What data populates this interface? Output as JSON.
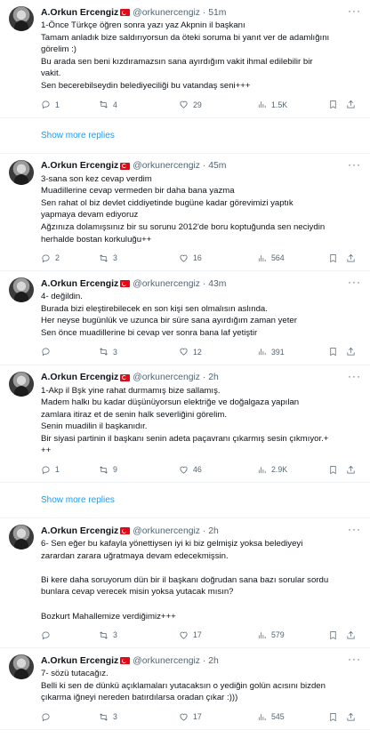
{
  "user": {
    "name": "A.Orkun Ercengiz",
    "handle": "@orkunercengiz"
  },
  "tweets": [
    {
      "time": "51m",
      "lines": [
        "1-Önce Türkçe öğren sonra yazı yaz Akpnin il başkanı",
        "Tamam anladık bize saldırıyorsun da öteki soruma bi yanıt ver de adamlığını",
        "görelim :)",
        "Bu arada sen beni kızdıramazsın sana ayırdığım vakit ihmal edilebilir bir",
        "vakit.",
        "Sen becerebilseydin belediyeciliği bu vatandaş seni+++"
      ],
      "replies": "1",
      "reposts": "4",
      "likes": "29",
      "views": "1.5K"
    },
    {
      "time": "45m",
      "lines": [
        "3-sana son kez cevap verdim",
        "Muadillerine cevap vermeden bir daha bana yazma",
        "Sen rahat ol biz devlet ciddiyetinde bugüne kadar görevimizi yaptık",
        "yapmaya devam ediyoruz",
        "Ağzınıza dolamışsınız bir su sorunu 2012'de boru koptuğunda sen neciydin",
        "herhalde bostan korkuluğu++"
      ],
      "replies": "2",
      "reposts": "3",
      "likes": "16",
      "views": "564"
    },
    {
      "time": "43m",
      "lines": [
        "4- değildin.",
        "Burada bizi eleştirebilecek en son kişi sen olmalısın aslında.",
        "Her neyse bugünlük ve uzunca bir süre sana ayırdığım zaman yeter",
        "Sen önce muadillerine bi cevap ver sonra bana laf yetiştir"
      ],
      "replies": "",
      "reposts": "3",
      "likes": "12",
      "views": "391"
    },
    {
      "time": "2h",
      "lines": [
        "1-Akp il Bşk yine rahat durmamış bize sallamış.",
        "Madem halkı bu kadar düşünüyorsun elektriğe ve doğalgaza yapılan",
        "zamlara itiraz et de senin halk severliğini görelim.",
        "Senin muadilin il başkanıdır.",
        "Bir siyasi partinin il başkanı senin adeta paçavranı çıkarmış sesin çıkmıyor.+",
        "++"
      ],
      "replies": "1",
      "reposts": "9",
      "likes": "46",
      "views": "2.9K"
    },
    {
      "time": "2h",
      "lines": [
        "6- Sen eğer bu kafayla yönettiysen iyi ki biz gelmişiz yoksa belediyeyi",
        "zarardan zarara uğratmaya devam edecekmişsin.",
        "",
        "Bi kere daha soruyorum dün bir il başkanı doğrudan sana bazı sorular sordu",
        "bunlara cevap verecek misin yoksa yutacak mısın?",
        "",
        "Bozkurt Mahallemize  verdiğimiz+++"
      ],
      "replies": "",
      "reposts": "3",
      "likes": "17",
      "views": "579"
    },
    {
      "time": "2h",
      "lines": [
        "7- sözü tutacağız.",
        "Belli ki sen de dünkü açıklamaları yutacaksın o yediğin golün acısını bizden",
        "çıkarma iğneyi nereden batırdılarsa oradan çıkar :)))"
      ],
      "replies": "",
      "reposts": "3",
      "likes": "17",
      "views": "545"
    }
  ],
  "show_more_replies": "Show more replies",
  "colors": {
    "accent": "#1d9bf0",
    "muted": "#536471",
    "flag": "#e30a17"
  }
}
